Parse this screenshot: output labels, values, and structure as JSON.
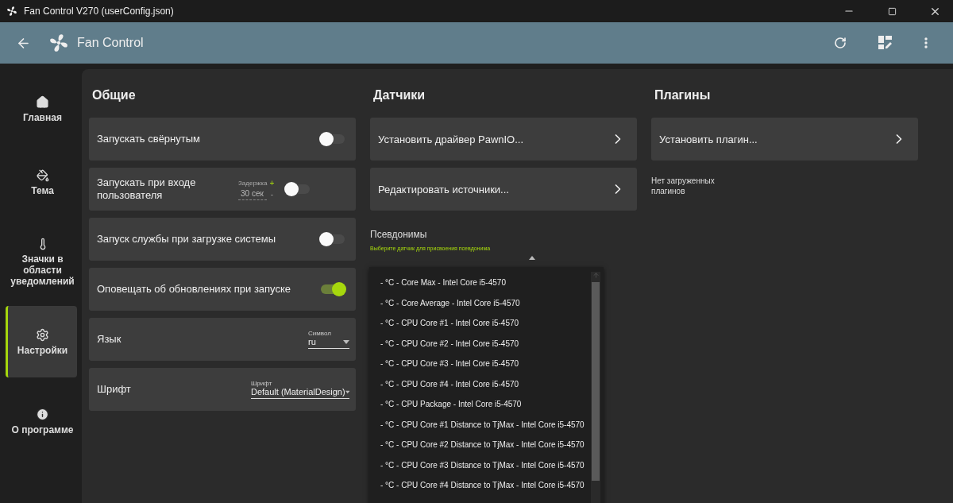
{
  "window": {
    "title": "Fan Control V270 (userConfig.json)"
  },
  "app_bar": {
    "title": "Fan Control"
  },
  "sidebar": {
    "items": [
      {
        "label": "Главная",
        "selected": false
      },
      {
        "label": "Тема",
        "selected": false
      },
      {
        "label": "Значки в области уведомлений",
        "selected": false
      },
      {
        "label": "Настройки",
        "selected": true
      },
      {
        "label": "О программе",
        "selected": false
      }
    ]
  },
  "general": {
    "title": "Общие",
    "cards": [
      {
        "kind": "toggle",
        "label": "Запускать свёрнутым",
        "on": false
      },
      {
        "kind": "toggle_delay",
        "label": "Запускать при входе пользователя",
        "on": false,
        "delay_label": "Задержка",
        "delay_value": "30 сек",
        "plus": "+",
        "minus": "-"
      },
      {
        "kind": "toggle",
        "label": "Запуск службы при загрузке системы",
        "on": false
      },
      {
        "kind": "toggle",
        "label": "Оповещать об обновлениях при запуске",
        "on": true
      },
      {
        "kind": "select",
        "label": "Язык",
        "field_label": "Символ",
        "value": "ru"
      },
      {
        "kind": "select",
        "label": "Шрифт",
        "field_label": "Шрифт",
        "value": "Default (MaterialDesign)"
      }
    ]
  },
  "sensors": {
    "title": "Датчики",
    "actions": [
      {
        "label": "Установить драйвер PawnIO..."
      },
      {
        "label": "Редактировать источники..."
      }
    ],
    "aliases": {
      "title": "Псевдонимы",
      "field_label": "Выберите датчик для присвоения псевдонима",
      "expanded": true,
      "options": [
        "- °C - Core Max - Intel Core i5-4570",
        "- °C - Core Average - Intel Core i5-4570",
        "- °C - CPU Core #1 - Intel Core i5-4570",
        "- °C - CPU Core #2 - Intel Core i5-4570",
        "- °C - CPU Core #3 - Intel Core i5-4570",
        "- °C - CPU Core #4 - Intel Core i5-4570",
        "- °C - CPU Package - Intel Core i5-4570",
        "- °C - CPU Core #1 Distance to TjMax - Intel Core i5-4570",
        "- °C - CPU Core #2 Distance to TjMax - Intel Core i5-4570",
        "- °C - CPU Core #3 Distance to TjMax - Intel Core i5-4570",
        "- °C - CPU Core #4 Distance to TjMax - Intel Core i5-4570"
      ]
    }
  },
  "plugins": {
    "title": "Плагины",
    "actions": [
      {
        "label": "Установить плагин..."
      }
    ],
    "empty_text": "Нет загруженных плагинов"
  }
}
